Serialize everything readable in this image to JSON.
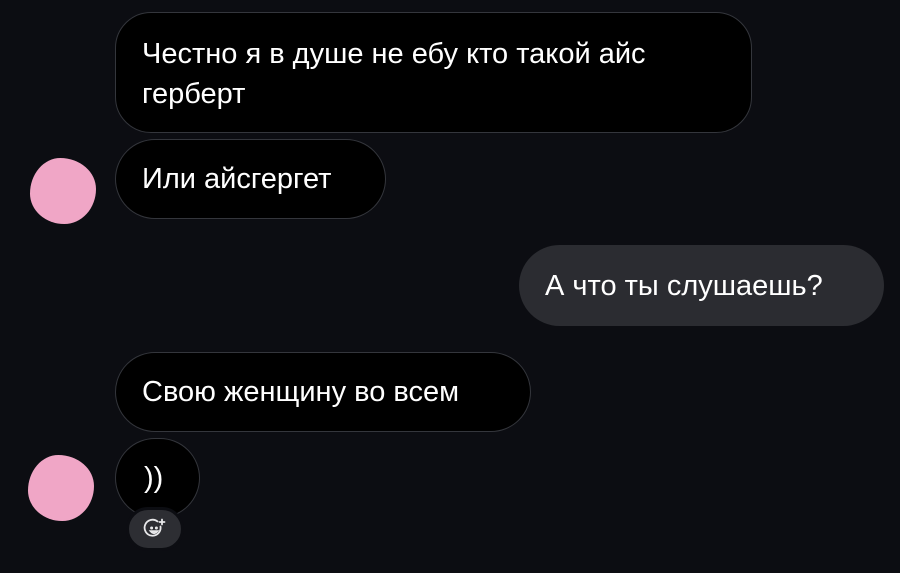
{
  "conversation": {
    "messages": [
      {
        "direction": "incoming",
        "text": "Честно я в душе не ебу кто такой айс\nгерберт"
      },
      {
        "direction": "incoming",
        "text": "Или айсгергет"
      },
      {
        "direction": "outgoing",
        "text": "А что ты слушаешь?"
      },
      {
        "direction": "incoming",
        "text": "Свою женщину во всем"
      },
      {
        "direction": "incoming",
        "text": "))"
      }
    ]
  },
  "icons": {
    "avatar": "avatar-blurred-pink",
    "reaction": "add-reaction-smiley-icon"
  },
  "colors": {
    "background": "#0c0d12",
    "incoming_bubble": "#000000",
    "incoming_border": "#34363c",
    "outgoing_bubble": "#2b2c31",
    "text": "#ffffff",
    "avatar": "#f0a6c6"
  }
}
